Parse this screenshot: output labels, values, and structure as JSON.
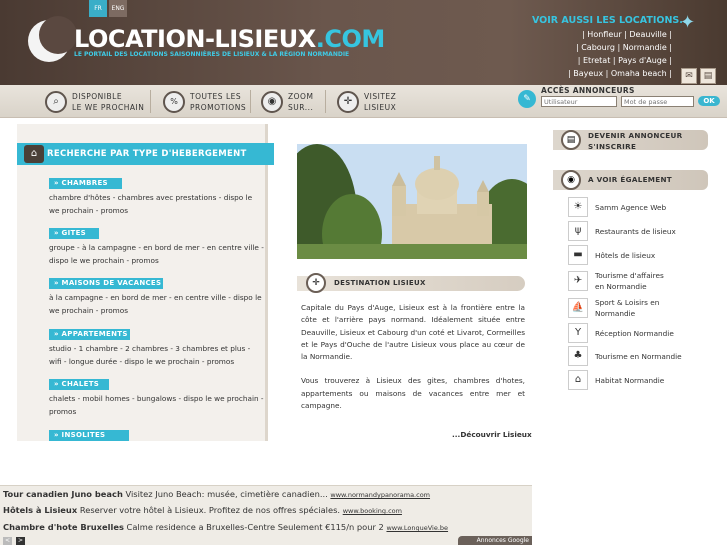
{
  "header": {
    "lang_fr": "FR",
    "lang_en": "ENG",
    "logo_main": "LOCATION-LISIEUX",
    "logo_ext": ".COM",
    "tagline": "LE PORTAIL DES LOCATIONS SAISONNIÈRES DE LISIEUX & LA RÉGION NORMANDIE",
    "see_also_title": "VOIR AUSSI LES LOCATIONS...",
    "see_also_links": [
      "| Honfleur | Deauville |",
      "| Cabourg | Normandie |",
      "| Etretat | Pays d'Auge |",
      "| Bayeux | Omaha beach |"
    ]
  },
  "toolbar": {
    "items": [
      {
        "line1": "DISPONIBLE",
        "line2": "LE WE PROCHAIN",
        "icon": "magnifier-icon"
      },
      {
        "line1": "TOUTES LES",
        "line2": "PROMOTIONS",
        "icon": "percent-icon"
      },
      {
        "line1": "ZOOM",
        "line2": "SUR...",
        "icon": "camera-icon"
      },
      {
        "line1": "VISITEZ",
        "line2": "LISIEUX",
        "icon": "compass-icon"
      }
    ],
    "annonceurs_title": "ACCÈS ANNONCEURS",
    "user_placeholder": "Utilisateur",
    "pass_placeholder": "Mot de passe",
    "ok_label": "OK"
  },
  "left": {
    "title": "RECHERCHE PAR TYPE D'HEBERGEMENT",
    "categories": [
      {
        "name": "» CHAMBRES",
        "desc": "chambre d'hôtes - chambres avec prestations - dispo le we prochain - promos"
      },
      {
        "name": "» GITES",
        "desc": "groupe - à la campagne - en bord de mer - en centre ville - dispo le we prochain - promos"
      },
      {
        "name": "» MAISONS DE VACANCES",
        "desc": "à la campagne - en bord de mer - en centre ville - dispo le we prochain - promos"
      },
      {
        "name": "» APPARTEMENTS",
        "desc": "studio - 1 chambre - 2 chambres - 3 chambres et plus - wifi - longue durée - dispo le we prochain - promos"
      },
      {
        "name": "» CHALETS",
        "desc": "chalets - mobil homes - bungalows - dispo le we prochain - promos"
      },
      {
        "name": "» INSOLITES",
        "desc": ""
      }
    ]
  },
  "center": {
    "dest_title": "DESTINATION LISIEUX",
    "dest_p1": "Capitale du Pays d'Auge, Lisieux est à la frontière entre la côte et l'arrière pays normand. Idéalement située entre Deauville, Lisieux et Cabourg d'un coté et Livarot, Cormeilles et le Pays d'Ouche de l'autre Lisieux vous place au cœur de la Normandie.",
    "dest_p2": "Vous trouverez à Lisieux des gites, chambres d'hotes, appartements ou maisons de vacances entre mer et campagne.",
    "discover": "...Découvrir Lisieux"
  },
  "right": {
    "become_line1": "DEVENIR ANNONCEUR",
    "become_line2": "S'INSCRIRE",
    "see_also_title": "A VOIR ÉGALEMENT",
    "links": [
      {
        "label": "Samm Agence Web",
        "icon": "sun-icon"
      },
      {
        "label": "Restaurants de lisieux",
        "icon": "cutlery-icon"
      },
      {
        "label": "Hôtels de lisieux",
        "icon": "bed-icon"
      },
      {
        "label": "Tourisme d'affaires en Normandie",
        "icon": "plane-icon"
      },
      {
        "label": "Sport & Loisirs en Normandie",
        "icon": "sailboat-icon"
      },
      {
        "label": "Réception Normandie",
        "icon": "glass-icon"
      },
      {
        "label": "Tourisme en Normandie",
        "icon": "palm-icon"
      },
      {
        "label": "Habitat Normandie",
        "icon": "house-icon"
      }
    ]
  },
  "ads": {
    "items": [
      {
        "title": "Tour canadien Juno beach",
        "text": " Visitez Juno Beach: musée, cimetière canadien... ",
        "url": "www.normandypanorama.com"
      },
      {
        "title": "Hôtels à Lisieux",
        "text": " Reserver votre hôtel à Lisieux. Profitez de nos offres spéciales. ",
        "url": "www.booking.com"
      },
      {
        "title": "Chambre d'hote Bruxelles",
        "text": " Calme residence a Bruxelles-Centre Seulement €115/n pour 2 ",
        "url": "www.LongueVie.be"
      }
    ],
    "footer": "Annonces Google",
    "prev": "<",
    "next": ">"
  }
}
